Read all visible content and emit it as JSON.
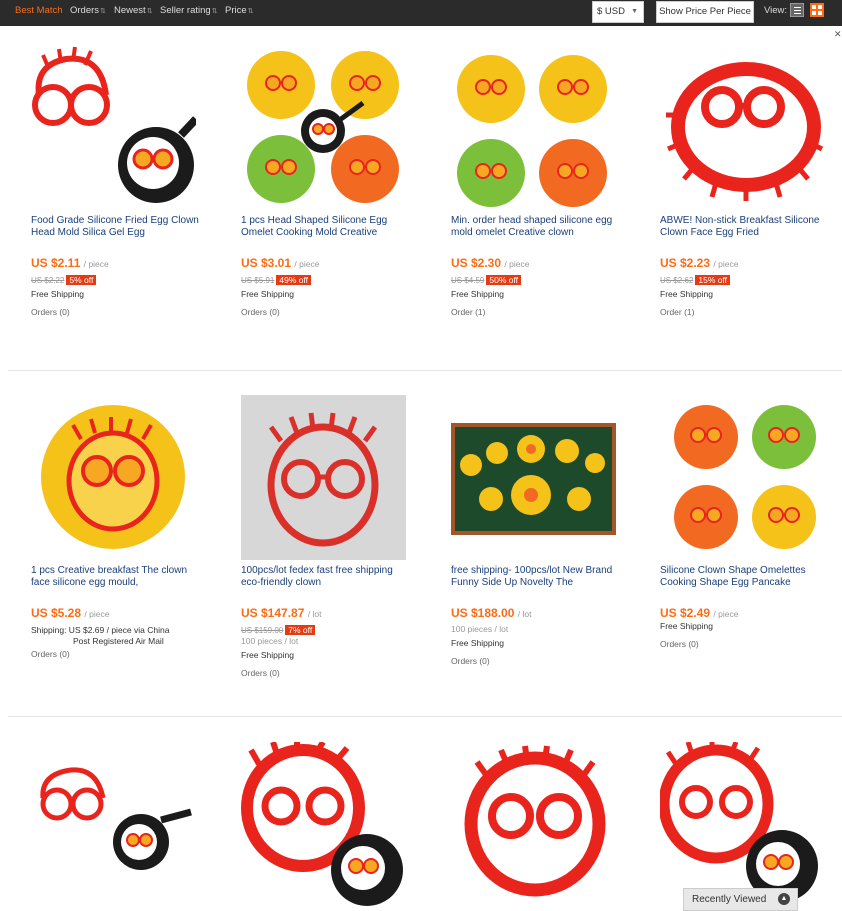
{
  "sortbar": {
    "items": [
      {
        "label": "Best Match",
        "active": true
      },
      {
        "label": "Orders",
        "active": false
      },
      {
        "label": "Newest",
        "active": false
      },
      {
        "label": "Seller rating",
        "active": false
      },
      {
        "label": "Price",
        "active": false
      }
    ],
    "currency": "$ USD",
    "price_per_piece": "Show Price Per Piece",
    "view_label": "View:"
  },
  "colors": {
    "accent": "#ff6a13",
    "badge": "#e43b14",
    "link": "#1a3f7a",
    "mold_red": "#e8241d"
  },
  "products": [
    {
      "title": "Food Grade Silicone Fried Egg Clown Head Mold Silica Gel Egg",
      "price": "US $2.11",
      "unit": "/ piece",
      "original": "US $2.22",
      "discount": "5% off",
      "shipping": "Free Shipping",
      "orders": "Orders (0)"
    },
    {
      "title": "1 pcs Head Shaped Silicone Egg Omelet Cooking Mold Creative",
      "price": "US $3.01",
      "unit": "/ piece",
      "original": "US $5.91",
      "discount": "49% off",
      "shipping": "Free Shipping",
      "orders": "Orders (0)"
    },
    {
      "title": "Min. order head shaped silicone egg mold omelet Creative clown",
      "price": "US $2.30",
      "unit": "/ piece",
      "original": "US $4.59",
      "discount": "50% off",
      "shipping": "Free Shipping",
      "orders": "Order (1)"
    },
    {
      "title": "ABWE! Non-stick Breakfast Silicone Clown Face Egg Fried",
      "price": "US $2.23",
      "unit": "/ piece",
      "original": "US $2.62",
      "discount": "15% off",
      "shipping": "Free Shipping",
      "orders": "Order (1)"
    },
    {
      "title": "1 pcs Creative breakfast The clown face silicone egg mould,",
      "price": "US $5.28",
      "unit": "/ piece",
      "shipping_line1": "Shipping: US $2.69 / piece via China",
      "shipping_line2": "Post Registered Air Mail",
      "orders": "Orders (0)"
    },
    {
      "title": "100pcs/lot fedex fast free shipping eco-friendly clown",
      "price": "US $147.87",
      "unit": "/ lot",
      "original": "US $159.00",
      "discount": "7% off",
      "pieces": "100 pieces / lot",
      "shipping": "Free Shipping",
      "orders": "Orders (0)"
    },
    {
      "title": "free shipping- 100pcs/lot New Brand Funny Side Up Novelty The",
      "price": "US $188.00",
      "unit": "/ lot",
      "pieces": "100 pieces / lot",
      "shipping": "Free Shipping",
      "orders": "Orders (0)"
    },
    {
      "title": "Silicone Clown Shape Omelettes Cooking Shape Egg Pancake",
      "price": "US $2.49",
      "unit": "/ piece",
      "shipping": "Free Shipping",
      "orders": "Orders (0)"
    }
  ],
  "recently_viewed": "Recently Viewed"
}
